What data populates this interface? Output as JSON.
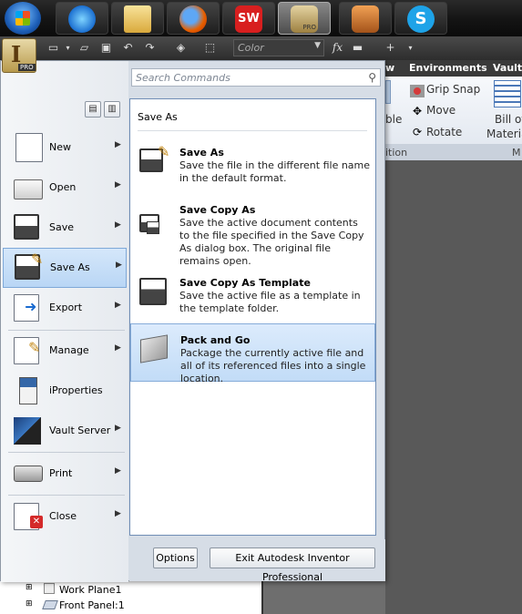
{
  "taskbar": {
    "apps": [
      {
        "name": "itunes-icon"
      },
      {
        "name": "folder-icon"
      },
      {
        "name": "firefox-icon"
      },
      {
        "name": "solidworks-icon",
        "text": "SW"
      },
      {
        "name": "inventor-icon",
        "text": "PRO"
      },
      {
        "name": "inventor-alt-icon"
      },
      {
        "name": "skype-icon",
        "text": "S"
      }
    ]
  },
  "app_button": {
    "letter": "I",
    "badge": "PRO"
  },
  "qat": {
    "color_placeholder": "Color",
    "fx": "fx"
  },
  "ribbon": {
    "tabs": [
      "w",
      "Environments",
      "Vault"
    ],
    "items": {
      "grip_snap": "Grip Snap",
      "move": "Move",
      "rotate": "Rotate",
      "bill_of": "Bill of",
      "materia": "Materia",
      "ble": "ble"
    },
    "panel_labels": {
      "position": "ition",
      "m": "M"
    }
  },
  "search": {
    "placeholder": "Search Commands"
  },
  "left_menu": [
    {
      "label": "New"
    },
    {
      "label": "Open"
    },
    {
      "label": "Save"
    },
    {
      "label": "Save As"
    },
    {
      "label": "Export"
    },
    {
      "label": "Manage"
    },
    {
      "label": "iProperties"
    },
    {
      "label": "Vault Server"
    },
    {
      "label": "Print"
    },
    {
      "label": "Close"
    }
  ],
  "submenu": {
    "title": "Save As",
    "items": [
      {
        "title": "Save As",
        "desc": "Save the file in the different file name in the default format."
      },
      {
        "title": "Save Copy As",
        "desc": "Save the active document contents to the file specified in the Save Copy As dialog box. The original file remains open."
      },
      {
        "title": "Save Copy As Template",
        "desc": "Save the active file as a template in the template folder."
      },
      {
        "title": "Pack and Go",
        "desc": "Package the currently active file and all of its referenced files into a single location."
      }
    ]
  },
  "buttons": {
    "options": "Options",
    "exit": "Exit Autodesk Inventor Professional"
  },
  "browser": {
    "rows": [
      "Work Plane1",
      "Front Panel:1"
    ]
  }
}
